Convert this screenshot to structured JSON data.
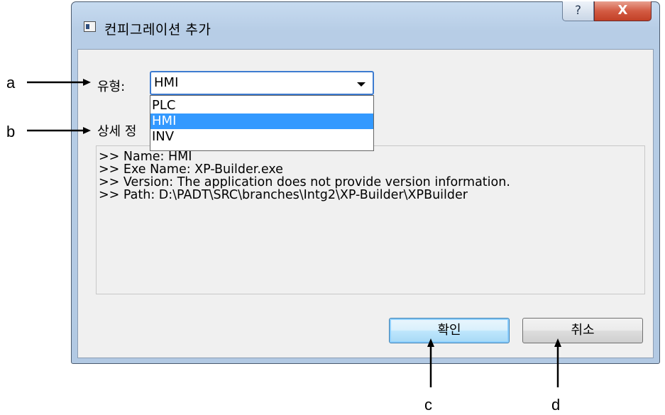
{
  "window": {
    "title": "컨피그레이션 추가",
    "help_label": "?",
    "close_label": "X"
  },
  "form": {
    "type_label": "유형:",
    "type_value": "HMI",
    "detail_label": "상세 정",
    "dropdown_options": [
      {
        "label": "PLC",
        "selected": false
      },
      {
        "label": "HMI",
        "selected": true
      },
      {
        "label": "INV",
        "selected": false
      }
    ],
    "detail_lines": [
      ">> Name: HMI",
      ">> Exe Name: XP-Builder.exe",
      ">> Version: The application does not provide version information.",
      ">> Path: D:\\PADT\\SRC\\branches\\Intg2\\XP-Builder\\XPBuilder"
    ]
  },
  "buttons": {
    "ok_label": "확인",
    "cancel_label": "취소"
  },
  "annotations": {
    "a": "a",
    "b": "b",
    "c": "c",
    "d": "d"
  },
  "colors": {
    "selection": "#3399ff",
    "close_button": "#c24026",
    "combo_focus": "#3d7bd0"
  }
}
